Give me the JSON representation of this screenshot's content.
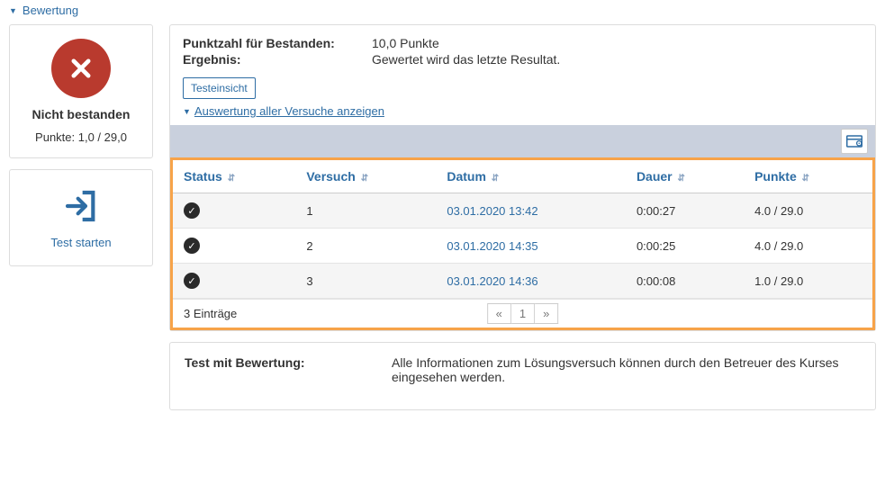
{
  "accordion": {
    "title": "Bewertung"
  },
  "status_box": {
    "title": "Nicht bestanden",
    "points_label": "Punkte: 1,0 / 29,0"
  },
  "start_box": {
    "label": "Test starten"
  },
  "summary": {
    "pass_label": "Punktzahl für Bestanden:",
    "pass_value": "10,0 Punkte",
    "result_label": "Ergebnis:",
    "result_value": "Gewertet wird das letzte Resultat."
  },
  "actions": {
    "insight_btn": "Testeinsicht",
    "show_all_link": "Auswertung aller Versuche anzeigen"
  },
  "table": {
    "headers": {
      "status": "Status",
      "attempt": "Versuch",
      "date": "Datum",
      "duration": "Dauer",
      "points": "Punkte"
    },
    "rows": [
      {
        "attempt": "1",
        "date": "03.01.2020 13:42",
        "duration": "0:00:27",
        "points": "4.0 / 29.0"
      },
      {
        "attempt": "2",
        "date": "03.01.2020 14:35",
        "duration": "0:00:25",
        "points": "4.0 / 29.0"
      },
      {
        "attempt": "3",
        "date": "03.01.2020 14:36",
        "duration": "0:00:08",
        "points": "1.0 / 29.0"
      }
    ],
    "footer_entries": "3 Einträge",
    "pager": {
      "prev": "«",
      "page": "1",
      "next": "»"
    }
  },
  "info": {
    "label": "Test mit Bewertung:",
    "value": "Alle Informationen zum Lösungsversuch können durch den Betreuer des Kurses eingesehen werden."
  }
}
